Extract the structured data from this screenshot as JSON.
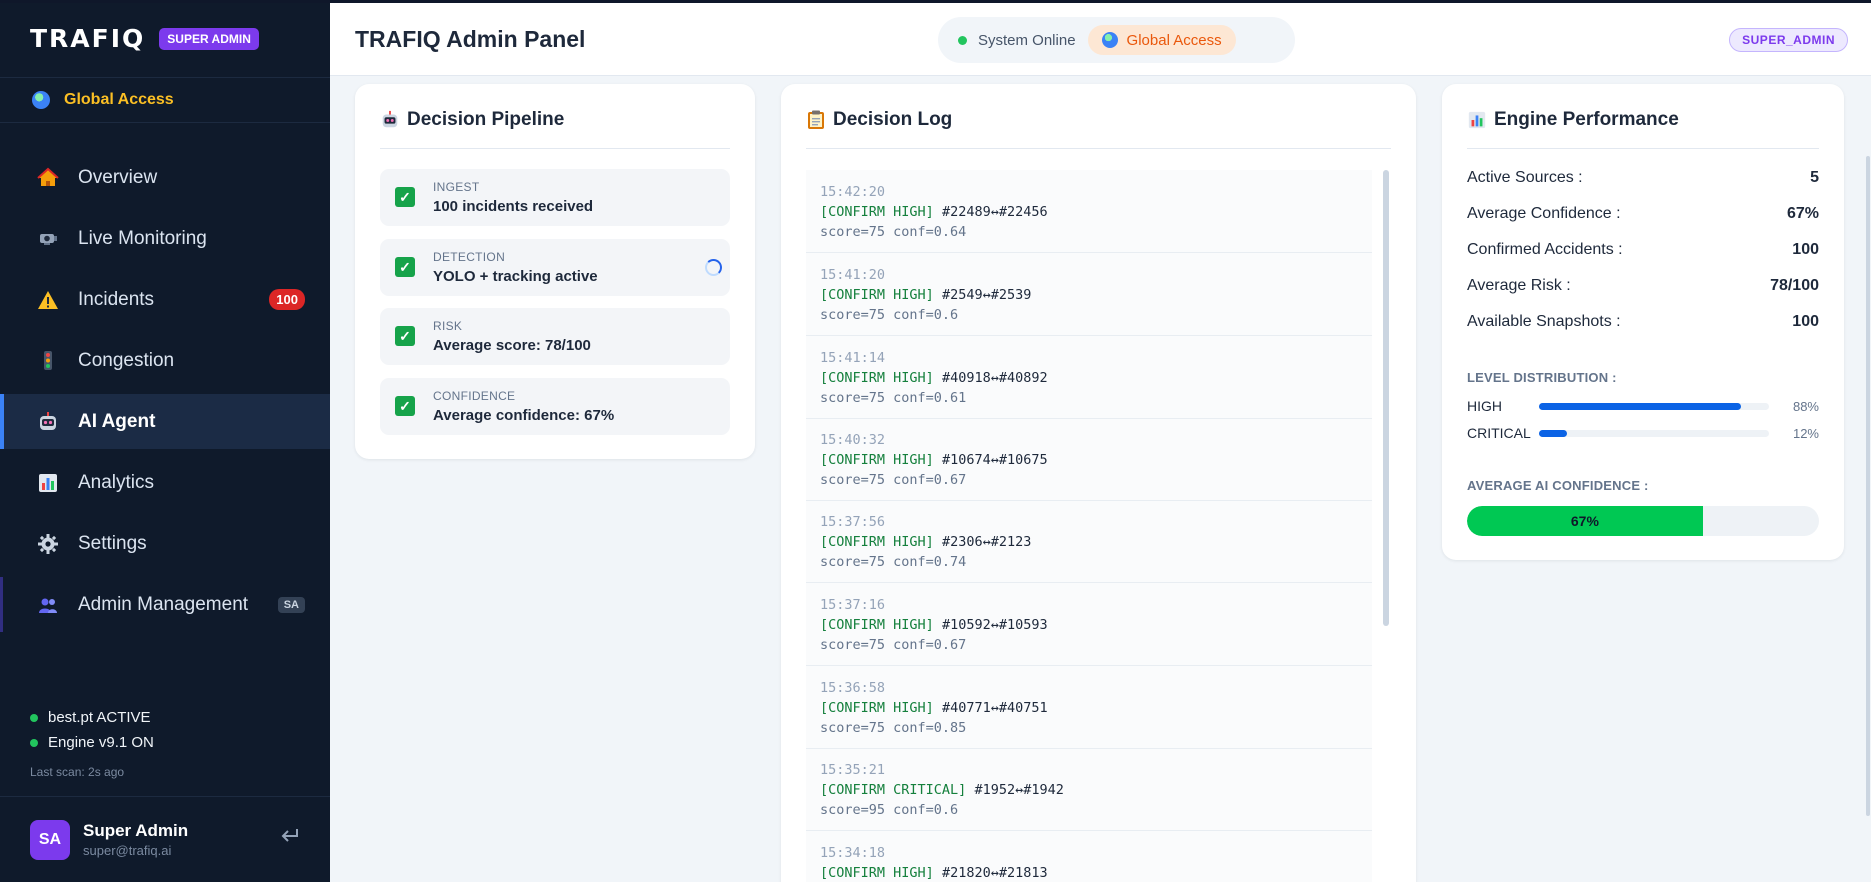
{
  "sidebar": {
    "logo": "TRAFIQ",
    "role_badge": "SUPER ADMIN",
    "access_label": "Global Access",
    "items": [
      {
        "label": "Overview",
        "icon": "home-icon"
      },
      {
        "label": "Live Monitoring",
        "icon": "camera-icon"
      },
      {
        "label": "Incidents",
        "icon": "warning-icon",
        "badge": "100"
      },
      {
        "label": "Congestion",
        "icon": "traffic-light-icon"
      },
      {
        "label": "AI Agent",
        "icon": "robot-icon",
        "active": true
      },
      {
        "label": "Analytics",
        "icon": "bar-chart-icon"
      },
      {
        "label": "Settings",
        "icon": "gear-icon"
      },
      {
        "label": "Admin Management",
        "icon": "users-icon",
        "badge": "SA"
      }
    ],
    "status": {
      "model": "best.pt ACTIVE",
      "engine": "Engine v9.1 ON",
      "last_scan": "Last scan: 2s ago"
    },
    "user": {
      "initials": "SA",
      "name": "Super Admin",
      "email": "super@trafiq.ai"
    }
  },
  "header": {
    "title": "TRAFIQ Admin Panel",
    "system_status": "System Online",
    "access": "Global Access",
    "role": "SUPER_ADMIN"
  },
  "pipeline": {
    "title": "Decision Pipeline",
    "steps": [
      {
        "label": "INGEST",
        "text": "100 incidents received"
      },
      {
        "label": "DETECTION",
        "text": "YOLO + tracking active"
      },
      {
        "label": "RISK",
        "text": "Average score: 78/100"
      },
      {
        "label": "CONFIDENCE",
        "text": "Average confidence: 67%"
      }
    ]
  },
  "log": {
    "title": "Decision Log",
    "entries": [
      {
        "time": "15:42:20",
        "action": "[CONFIRM HIGH]",
        "ids": "#22489↔#22456",
        "scores": "score=75 conf=0.64"
      },
      {
        "time": "15:41:20",
        "action": "[CONFIRM HIGH]",
        "ids": "#2549↔#2539",
        "scores": "score=75 conf=0.6"
      },
      {
        "time": "15:41:14",
        "action": "[CONFIRM HIGH]",
        "ids": "#40918↔#40892",
        "scores": "score=75 conf=0.61"
      },
      {
        "time": "15:40:32",
        "action": "[CONFIRM HIGH]",
        "ids": "#10674↔#10675",
        "scores": "score=75 conf=0.67"
      },
      {
        "time": "15:37:56",
        "action": "[CONFIRM HIGH]",
        "ids": "#2306↔#2123",
        "scores": "score=75 conf=0.74"
      },
      {
        "time": "15:37:16",
        "action": "[CONFIRM HIGH]",
        "ids": "#10592↔#10593",
        "scores": "score=75 conf=0.67"
      },
      {
        "time": "15:36:58",
        "action": "[CONFIRM HIGH]",
        "ids": "#40771↔#40751",
        "scores": "score=75 conf=0.85"
      },
      {
        "time": "15:35:21",
        "action": "[CONFIRM CRITICAL]",
        "ids": "#1952↔#1942",
        "scores": "score=95 conf=0.6"
      },
      {
        "time": "15:34:18",
        "action": "[CONFIRM HIGH]",
        "ids": "#21820↔#21813",
        "scores": ""
      }
    ]
  },
  "performance": {
    "title": "Engine Performance",
    "metrics": [
      {
        "label": "Active Sources :",
        "value": "5"
      },
      {
        "label": "Average Confidence :",
        "value": "67%"
      },
      {
        "label": "Confirmed Accidents :",
        "value": "100"
      },
      {
        "label": "Average Risk :",
        "value": "78/100"
      },
      {
        "label": "Available Snapshots :",
        "value": "100"
      }
    ],
    "level_heading": "LEVEL DISTRIBUTION :",
    "levels": [
      {
        "name": "HIGH",
        "pct_label": "88%",
        "fraction": 0.88
      },
      {
        "name": "CRITICAL",
        "pct_label": "12%",
        "fraction": 0.12
      }
    ],
    "confidence_heading": "AVERAGE AI CONFIDENCE :",
    "confidence_label": "67%",
    "confidence_fraction": 0.67
  },
  "colors": {
    "sidebar_bg": "#0f1a2b",
    "accent": "#3b82f6",
    "brand_purple": "#7c3aed",
    "success": "#22c55e",
    "danger": "#dc2626",
    "access_orange": "#ea580c"
  }
}
